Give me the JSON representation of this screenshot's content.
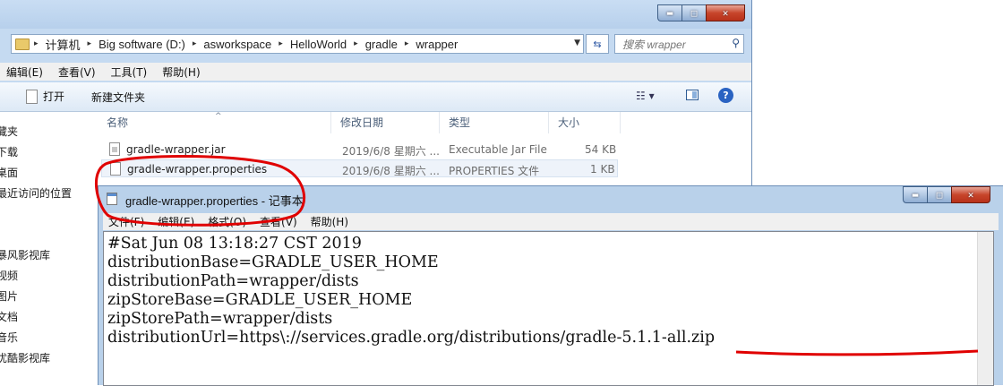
{
  "explorer": {
    "caption_buttons": {
      "min": "▬",
      "max": "□",
      "close": "✕"
    },
    "breadcrumbs": [
      "计算机",
      "Big software (D:)",
      "asworkspace",
      "HelloWorld",
      "gradle",
      "wrapper"
    ],
    "search_placeholder": "搜索 wrapper",
    "menu": [
      "编辑(E)",
      "查看(V)",
      "工具(T)",
      "帮助(H)"
    ],
    "toolbar": {
      "open": "打开",
      "new_folder": "新建文件夹",
      "view_icon": "☷ ▾",
      "help": "?"
    },
    "nav": [
      "藏夹",
      "下载",
      "桌面",
      "最近访问的位置",
      "暴风影视库",
      "视频",
      "图片",
      "文档",
      "音乐",
      "优酷影视库"
    ],
    "columns": [
      "名称",
      "修改日期",
      "类型",
      "大小"
    ],
    "sort_indicator": "^",
    "files": [
      {
        "name": "gradle-wrapper.jar",
        "date": "2019/6/8 星期六 ...",
        "type": "Executable Jar File",
        "size": "54 KB"
      },
      {
        "name": "gradle-wrapper.properties",
        "date": "2019/6/8 星期六 ...",
        "type": "PROPERTIES 文件",
        "size": "1 KB"
      }
    ]
  },
  "notepad": {
    "title": "gradle-wrapper.properties - 记事本",
    "caption_buttons": {
      "min": "▬",
      "max": "□",
      "close": "✕"
    },
    "menu": [
      "文件(F)",
      "编辑(E)",
      "格式(O)",
      "查看(V)",
      "帮助(H)"
    ],
    "lines": [
      "#Sat Jun 08 13:18:27 CST 2019",
      "distributionBase=GRADLE_USER_HOME",
      "distributionPath=wrapper/dists",
      "zipStoreBase=GRADLE_USER_HOME",
      "zipStorePath=wrapper/dists",
      "distributionUrl=https\\://services.gradle.org/distributions/gradle-5.1.1-all.zip"
    ]
  },
  "colors": {
    "annotation_red": "#e00000",
    "window_frame": "#c5daf1"
  }
}
